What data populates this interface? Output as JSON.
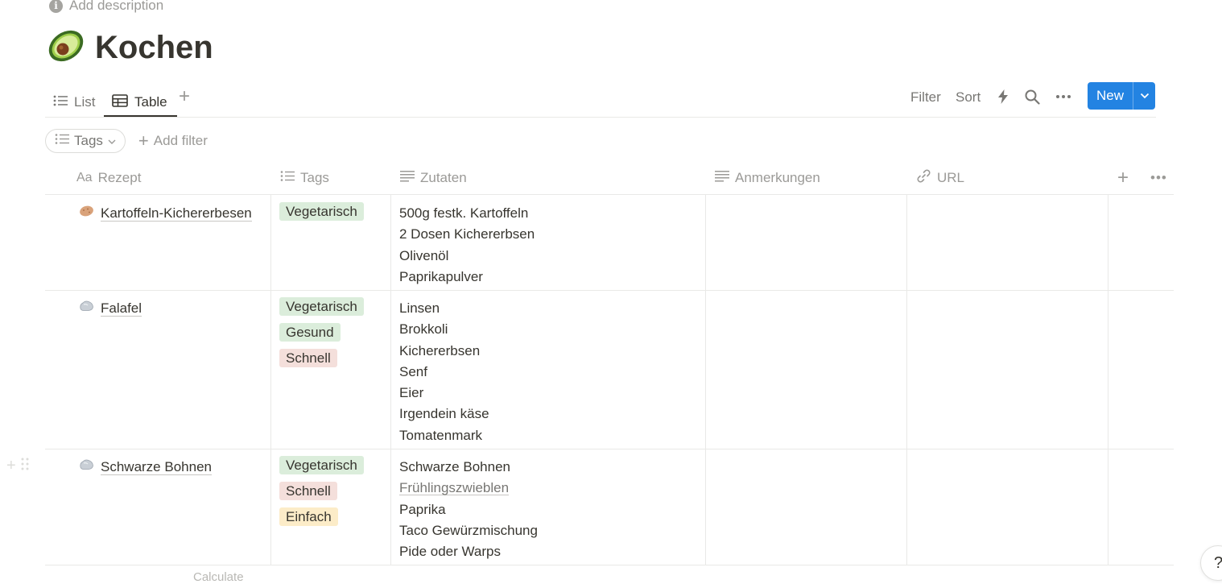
{
  "page": {
    "description_placeholder": "Add description",
    "title": "Kochen",
    "title_icon": "avocado-icon"
  },
  "views": {
    "tabs": [
      {
        "label": "List",
        "icon": "list-icon",
        "active": false
      },
      {
        "label": "Table",
        "icon": "table-icon",
        "active": true
      }
    ],
    "add_view_icon": "plus-icon"
  },
  "toolbar": {
    "filter_label": "Filter",
    "sort_label": "Sort",
    "automation_icon": "lightning-icon",
    "search_icon": "search-icon",
    "more_icon": "more-icon",
    "new_label": "New",
    "new_dropdown_icon": "chevron-down-icon",
    "accent_color": "#2383e2"
  },
  "filters": {
    "chip_label": "Tags",
    "add_filter_label": "Add filter"
  },
  "table": {
    "columns": [
      {
        "label": "Rezept",
        "icon": "text-aa-icon"
      },
      {
        "label": "Tags",
        "icon": "list-icon"
      },
      {
        "label": "Zutaten",
        "icon": "text-lines-icon"
      },
      {
        "label": "Anmerkungen",
        "icon": "text-lines-icon"
      },
      {
        "label": "URL",
        "icon": "link-icon"
      }
    ],
    "rows": [
      {
        "name": "Kartoffeln-Kichererbesen",
        "icon": "potato-icon",
        "tags": [
          {
            "label": "Vegetarisch",
            "color": "#dbeddb"
          }
        ],
        "ingredients": [
          "500g festk. Kartoffeln",
          "2 Dosen Kichererbsen",
          "Olivenöl",
          "Paprikapulver"
        ]
      },
      {
        "name": "Falafel",
        "icon": "rock-icon",
        "tags": [
          {
            "label": "Vegetarisch",
            "color": "#dbeddb"
          },
          {
            "label": "Gesund",
            "color": "#dbeddb"
          },
          {
            "label": "Schnell",
            "color": "#f4dfdb"
          }
        ],
        "ingredients": [
          "Linsen",
          "Brokkoli",
          "Kichererbsen",
          "Senf",
          "Eier",
          "Irgendein käse",
          "Tomatenmark"
        ]
      },
      {
        "name": "Schwarze Bohnen",
        "icon": "rock-icon",
        "tags": [
          {
            "label": "Vegetarisch",
            "color": "#dbeddb"
          },
          {
            "label": "Schnell",
            "color": "#f4dfdb"
          },
          {
            "label": "Einfach",
            "color": "#fcecc8"
          }
        ],
        "ingredients": [
          "Schwarze Bohnen",
          "Frühlingszwieblen",
          "Paprika",
          "Taco Gewürzmischung",
          "Pide oder Warps"
        ]
      }
    ]
  },
  "footer": {
    "calculate_label": "Calculate",
    "help_label": "?"
  }
}
